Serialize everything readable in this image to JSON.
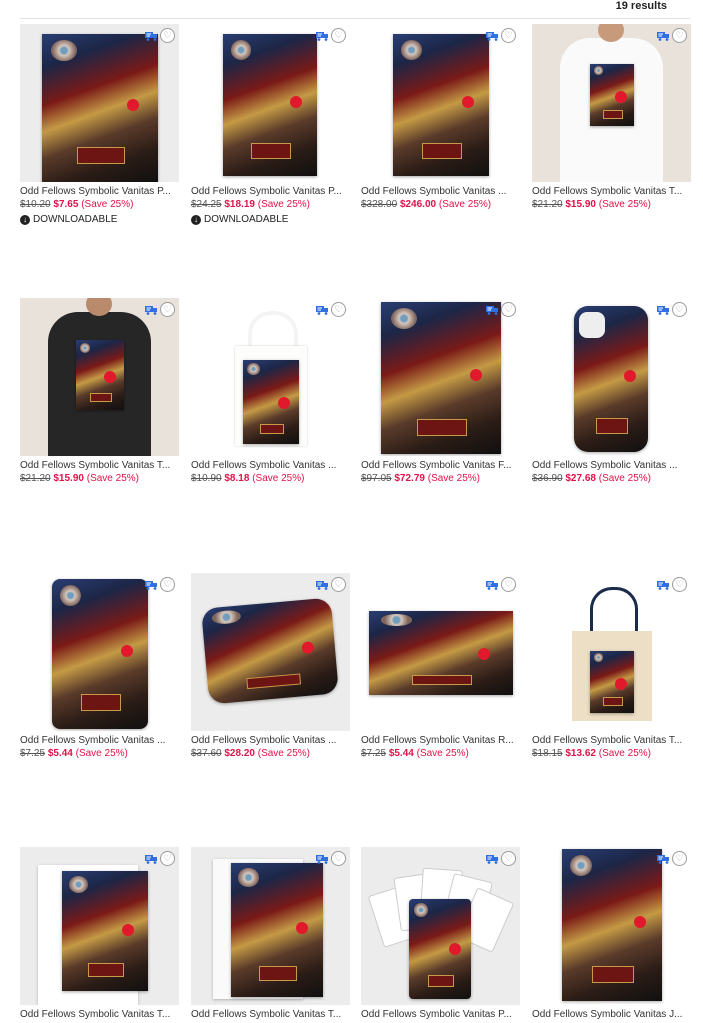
{
  "results_label": "19 results",
  "products": [
    {
      "title": "Odd Fellows Symbolic Vanitas P...",
      "old": "$10.20",
      "new": "$7.65",
      "save": "(Save 25%)",
      "downloadable": "DOWNLOADABLE",
      "kind": "poster"
    },
    {
      "title": "Odd Fellows Symbolic Vanitas P...",
      "old": "$24.25",
      "new": "$18.19",
      "save": "(Save 25%)",
      "downloadable": "DOWNLOADABLE",
      "kind": "poster2"
    },
    {
      "title": "Odd Fellows Symbolic Vanitas ...",
      "old": "$328.00",
      "new": "$246.00",
      "save": "(Save 25%)",
      "kind": "canvas"
    },
    {
      "title": "Odd Fellows Symbolic Vanitas T...",
      "old": "$21.20",
      "new": "$15.90",
      "save": "(Save 25%)",
      "kind": "tshirt-white"
    },
    {
      "title": "Odd Fellows Symbolic Vanitas T...",
      "old": "$21.20",
      "new": "$15.90",
      "save": "(Save 25%)",
      "kind": "tshirt-black"
    },
    {
      "title": "Odd Fellows Symbolic Vanitas ...",
      "old": "$10.90",
      "new": "$8.18",
      "save": "(Save 25%)",
      "kind": "grocery-bag"
    },
    {
      "title": "Odd Fellows Symbolic Vanitas F...",
      "old": "$97.05",
      "new": "$72.79",
      "save": "(Save 25%)",
      "kind": "fleece"
    },
    {
      "title": "Odd Fellows Symbolic Vanitas ...",
      "old": "$36.90",
      "new": "$27.68",
      "save": "(Save 25%)",
      "kind": "phone"
    },
    {
      "title": "Odd Fellows Symbolic Vanitas ...",
      "old": "$7.25",
      "new": "$5.44",
      "save": "(Save 25%)",
      "kind": "rounded-print"
    },
    {
      "title": "Odd Fellows Symbolic Vanitas ...",
      "old": "$37.60",
      "new": "$28.20",
      "save": "(Save 25%)",
      "kind": "pillow"
    },
    {
      "title": "Odd Fellows Symbolic Vanitas R...",
      "old": "$7.25",
      "new": "$5.44",
      "save": "(Save 25%)",
      "kind": "rect-print"
    },
    {
      "title": "Odd Fellows Symbolic Vanitas T...",
      "old": "$18.15",
      "new": "$13.62",
      "save": "(Save 25%)",
      "kind": "tote"
    },
    {
      "title": "Odd Fellows Symbolic Vanitas T...",
      "kind": "card-white"
    },
    {
      "title": "Odd Fellows Symbolic Vanitas T...",
      "kind": "card2"
    },
    {
      "title": "Odd Fellows Symbolic Vanitas P...",
      "kind": "playing-cards"
    },
    {
      "title": "Odd Fellows Symbolic Vanitas J...",
      "kind": "jigsaw"
    }
  ],
  "colors": {
    "sale": "#e0134a",
    "accent": "#2f6fe0"
  },
  "icons": {
    "fast_ship": "fast-shipping-icon",
    "favorite": "heart-outline-icon",
    "download": "download-icon"
  }
}
